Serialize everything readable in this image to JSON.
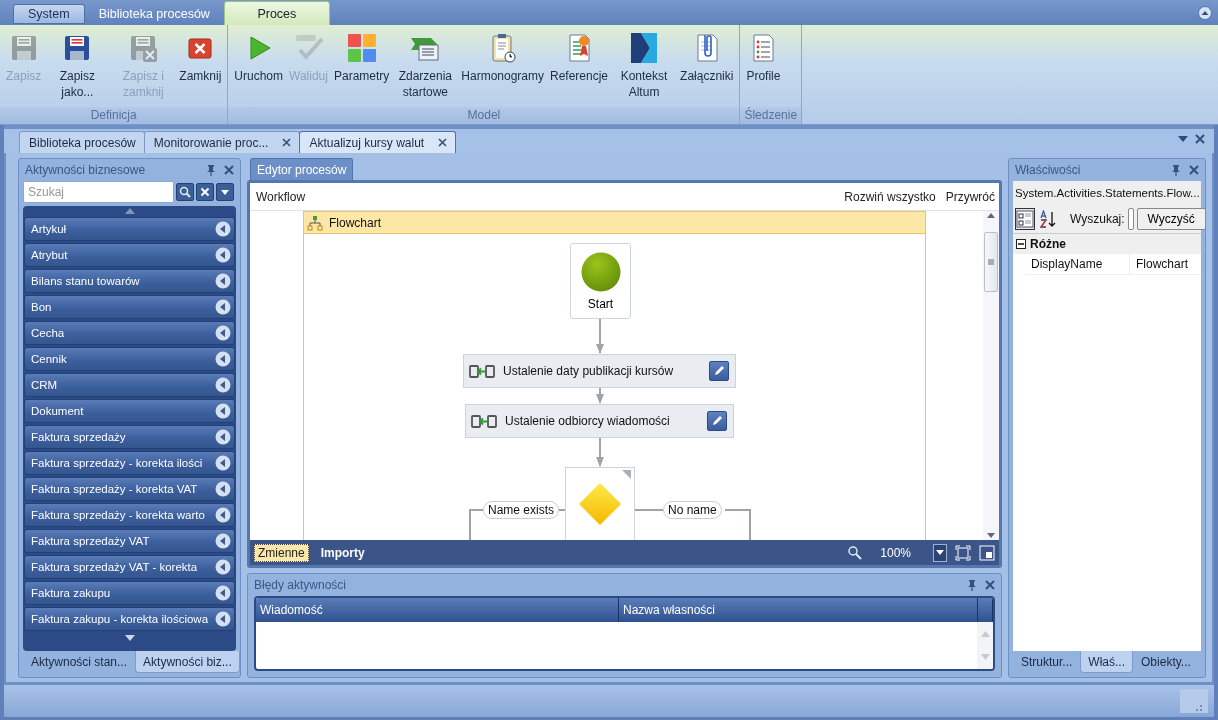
{
  "title_tabs": [
    {
      "label": "System",
      "kind": "application",
      "selected": false
    },
    {
      "label": "Biblioteka procesów",
      "kind": "tab",
      "selected": false
    },
    {
      "label": "Proces",
      "kind": "tab",
      "selected": true
    }
  ],
  "ribbon": {
    "groups": [
      {
        "label": "Definicja",
        "buttons": [
          {
            "label": "Zapisz",
            "disabled": true
          },
          {
            "label": "Zapisz jako...",
            "disabled": false
          },
          {
            "label": "Zapisz i zamknij",
            "disabled": true
          },
          {
            "label": "Zamknij",
            "disabled": false
          }
        ]
      },
      {
        "label": "Model",
        "buttons": [
          {
            "label": "Uruchom",
            "disabled": false
          },
          {
            "label": "Waliduj",
            "disabled": true
          },
          {
            "label": "Parametry",
            "disabled": false
          },
          {
            "label": "Zdarzenia startowe",
            "disabled": false
          },
          {
            "label": "Harmonogramy",
            "disabled": false
          },
          {
            "label": "Referencje",
            "disabled": false
          },
          {
            "label": "Kontekst Altum",
            "disabled": false
          },
          {
            "label": "Załączniki",
            "disabled": false
          }
        ]
      },
      {
        "label": "Śledzenie",
        "buttons": [
          {
            "label": "Profile",
            "disabled": false
          }
        ]
      }
    ]
  },
  "document_tabs": [
    {
      "label": "Biblioteka procesów",
      "selected": false,
      "closable": false
    },
    {
      "label": "Monitorowanie proc...",
      "selected": false,
      "closable": true
    },
    {
      "label": "Aktualizuj kursy walut",
      "selected": true,
      "closable": true
    }
  ],
  "activities_panel": {
    "title": "Aktywności biznesowe",
    "search": {
      "placeholder": "Szukaj"
    },
    "items": [
      "Artykuł",
      "Atrybut",
      "Bilans stanu towarów",
      "Bon",
      "Cecha",
      "Cennik",
      "CRM",
      "Dokument",
      "Faktura sprzedaży",
      "Faktura sprzedaży - korekta ilości",
      "Faktura sprzedaży - korekta VAT",
      "Faktura sprzedaży - korekta warto",
      "Faktura sprzedaży VAT",
      "Faktura sprzedaży VAT - korekta",
      "Faktura zakupu",
      "Faktura zakupu - korekta ilościowa"
    ],
    "bottom_tabs": [
      {
        "label": "Aktywności stan...",
        "selected": false
      },
      {
        "label": "Aktywności biz...",
        "selected": true
      }
    ]
  },
  "editor": {
    "tab": "Edytor procesów",
    "breadcrumb": "Workflow",
    "actions": [
      "Rozwiń wszystko",
      "Przywróć"
    ],
    "flowchart": {
      "title": "Flowchart",
      "nodes": [
        {
          "kind": "start",
          "label": "Start"
        },
        {
          "kind": "assign",
          "label": "Ustalenie daty publikacji kursów"
        },
        {
          "kind": "assign",
          "label": "Ustalenie odbiorcy wiadomości"
        },
        {
          "kind": "decision",
          "true_label": "Name exists",
          "false_label": "No name"
        }
      ]
    },
    "bottom_tabs": [
      {
        "label": "Zmienne",
        "selected": true
      },
      {
        "label": "Importy",
        "selected": false
      }
    ],
    "zoom": "100%"
  },
  "errors_panel": {
    "title": "Błędy aktywności",
    "columns": [
      "Wiadomość",
      "Nazwa własności"
    ]
  },
  "properties_panel": {
    "title": "Właściwości",
    "object": "System.Activities.Statements.Flow...",
    "sort_modes": [
      {
        "kind": "categorized",
        "selected": true
      },
      {
        "kind": "alphabetical",
        "selected": false
      }
    ],
    "search_label": "Wyszukaj:",
    "clear_button": "Wyczyść",
    "categories": [
      {
        "name": "Różne",
        "expanded": true,
        "rows": [
          {
            "name": "DisplayName",
            "value": "Flowchart"
          }
        ]
      }
    ],
    "bottom_tabs": [
      {
        "label": "Struktur...",
        "selected": false
      },
      {
        "label": "Właś...",
        "selected": true
      },
      {
        "label": "Obiekty...",
        "selected": false
      }
    ]
  }
}
